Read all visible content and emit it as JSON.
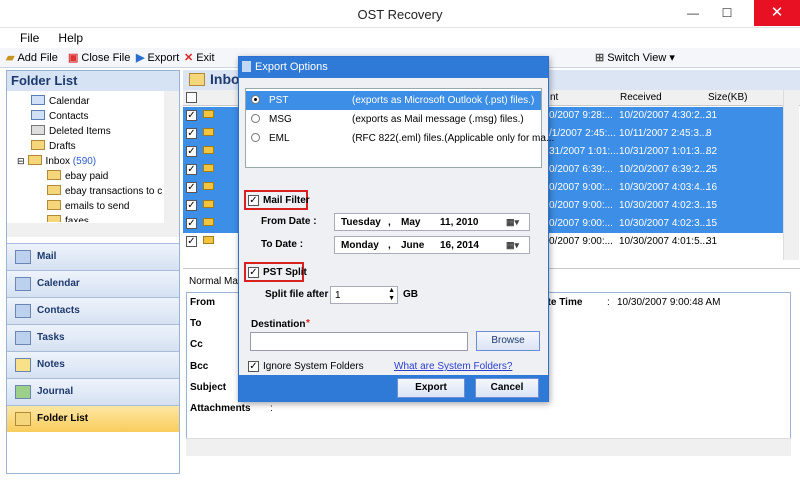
{
  "window": {
    "title": "OST Recovery",
    "close_glyph": "✕",
    "min_glyph": "—",
    "max_glyph": "☐"
  },
  "menu": {
    "items": [
      "File",
      "Help"
    ]
  },
  "toolbar": {
    "add_file": "Add File",
    "close_file": "Close File",
    "export": "Export",
    "exit": "Exit",
    "switch_view": "Switch View ▾"
  },
  "folder_list": {
    "header": "Folder List",
    "items": [
      "Calendar",
      "Contacts",
      "Deleted Items",
      "Drafts",
      "Inbox",
      "ebay paid",
      "ebay transactions to c",
      "emails to send",
      "faxes"
    ],
    "inbox_count": "(590)"
  },
  "nav": [
    "Mail",
    "Calendar",
    "Contacts",
    "Tasks",
    "Notes",
    "Journal",
    "Folder List"
  ],
  "inbox": {
    "title": "Inbox",
    "columns": {
      "sent": "nt",
      "received": "Received",
      "size": "Size(KB)"
    },
    "rows": [
      {
        "sent": "0/2007 9:28:...",
        "received": "10/20/2007 4:30:2...",
        "size": "31",
        "selected": true
      },
      {
        "sent": "/1/2007 2:45:...",
        "received": "10/11/2007 2:45:3...",
        "size": "8",
        "selected": true
      },
      {
        "sent": "31/2007 1:01:...",
        "received": "10/31/2007 1:01:3...",
        "size": "82",
        "selected": true
      },
      {
        "sent": "0/2007 6:39:...",
        "received": "10/20/2007 6:39:2...",
        "size": "25",
        "selected": true
      },
      {
        "sent": "0/2007 9:00:...",
        "received": "10/30/2007 4:03:4...",
        "size": "16",
        "selected": true
      },
      {
        "sent": "0/2007 9:00:...",
        "received": "10/30/2007 4:02:3...",
        "size": "15",
        "selected": true
      },
      {
        "sent": "0/2007 9:00:...",
        "received": "10/30/2007 4:02:3...",
        "size": "15",
        "selected": true
      },
      {
        "sent": "0/2007 9:00:...",
        "received": "10/30/2007 4:01:5...",
        "size": "31",
        "selected": false
      }
    ]
  },
  "reading": {
    "tab": "Normal Ma",
    "labels": [
      "From",
      "To",
      "Cc",
      "Bcc",
      "Subject",
      "Attachments"
    ],
    "date_label": "ate Time",
    "date_value": "10/30/2007 9:00:48 AM"
  },
  "dialog": {
    "title": "Export Options",
    "formats": [
      {
        "name": "PST",
        "desc": "(exports as Microsoft Outlook (.pst) files.)",
        "selected": true
      },
      {
        "name": "MSG",
        "desc": "(exports as Mail message (.msg) files.)",
        "selected": false
      },
      {
        "name": "EML",
        "desc": "(RFC 822(.eml) files.(Applicable only for ma...",
        "selected": false
      }
    ],
    "mail_filter": "Mail Filter",
    "from_date_label": "From Date :",
    "from_date": {
      "day": "Tuesday",
      "month": "May",
      "date": "11, 2010"
    },
    "to_date_label": "To Date :",
    "to_date": {
      "day": "Monday",
      "month": "June",
      "date": "16, 2014"
    },
    "pst_split": "PST Split",
    "split_label": "Split file after",
    "split_value": "1",
    "split_unit": "GB",
    "destination_label": "Destination",
    "destination_required": "*",
    "destination_value": "",
    "browse": "Browse",
    "ignore_system": "Ignore System Folders",
    "what_system": "What are System Folders?",
    "export": "Export",
    "cancel": "Cancel"
  }
}
